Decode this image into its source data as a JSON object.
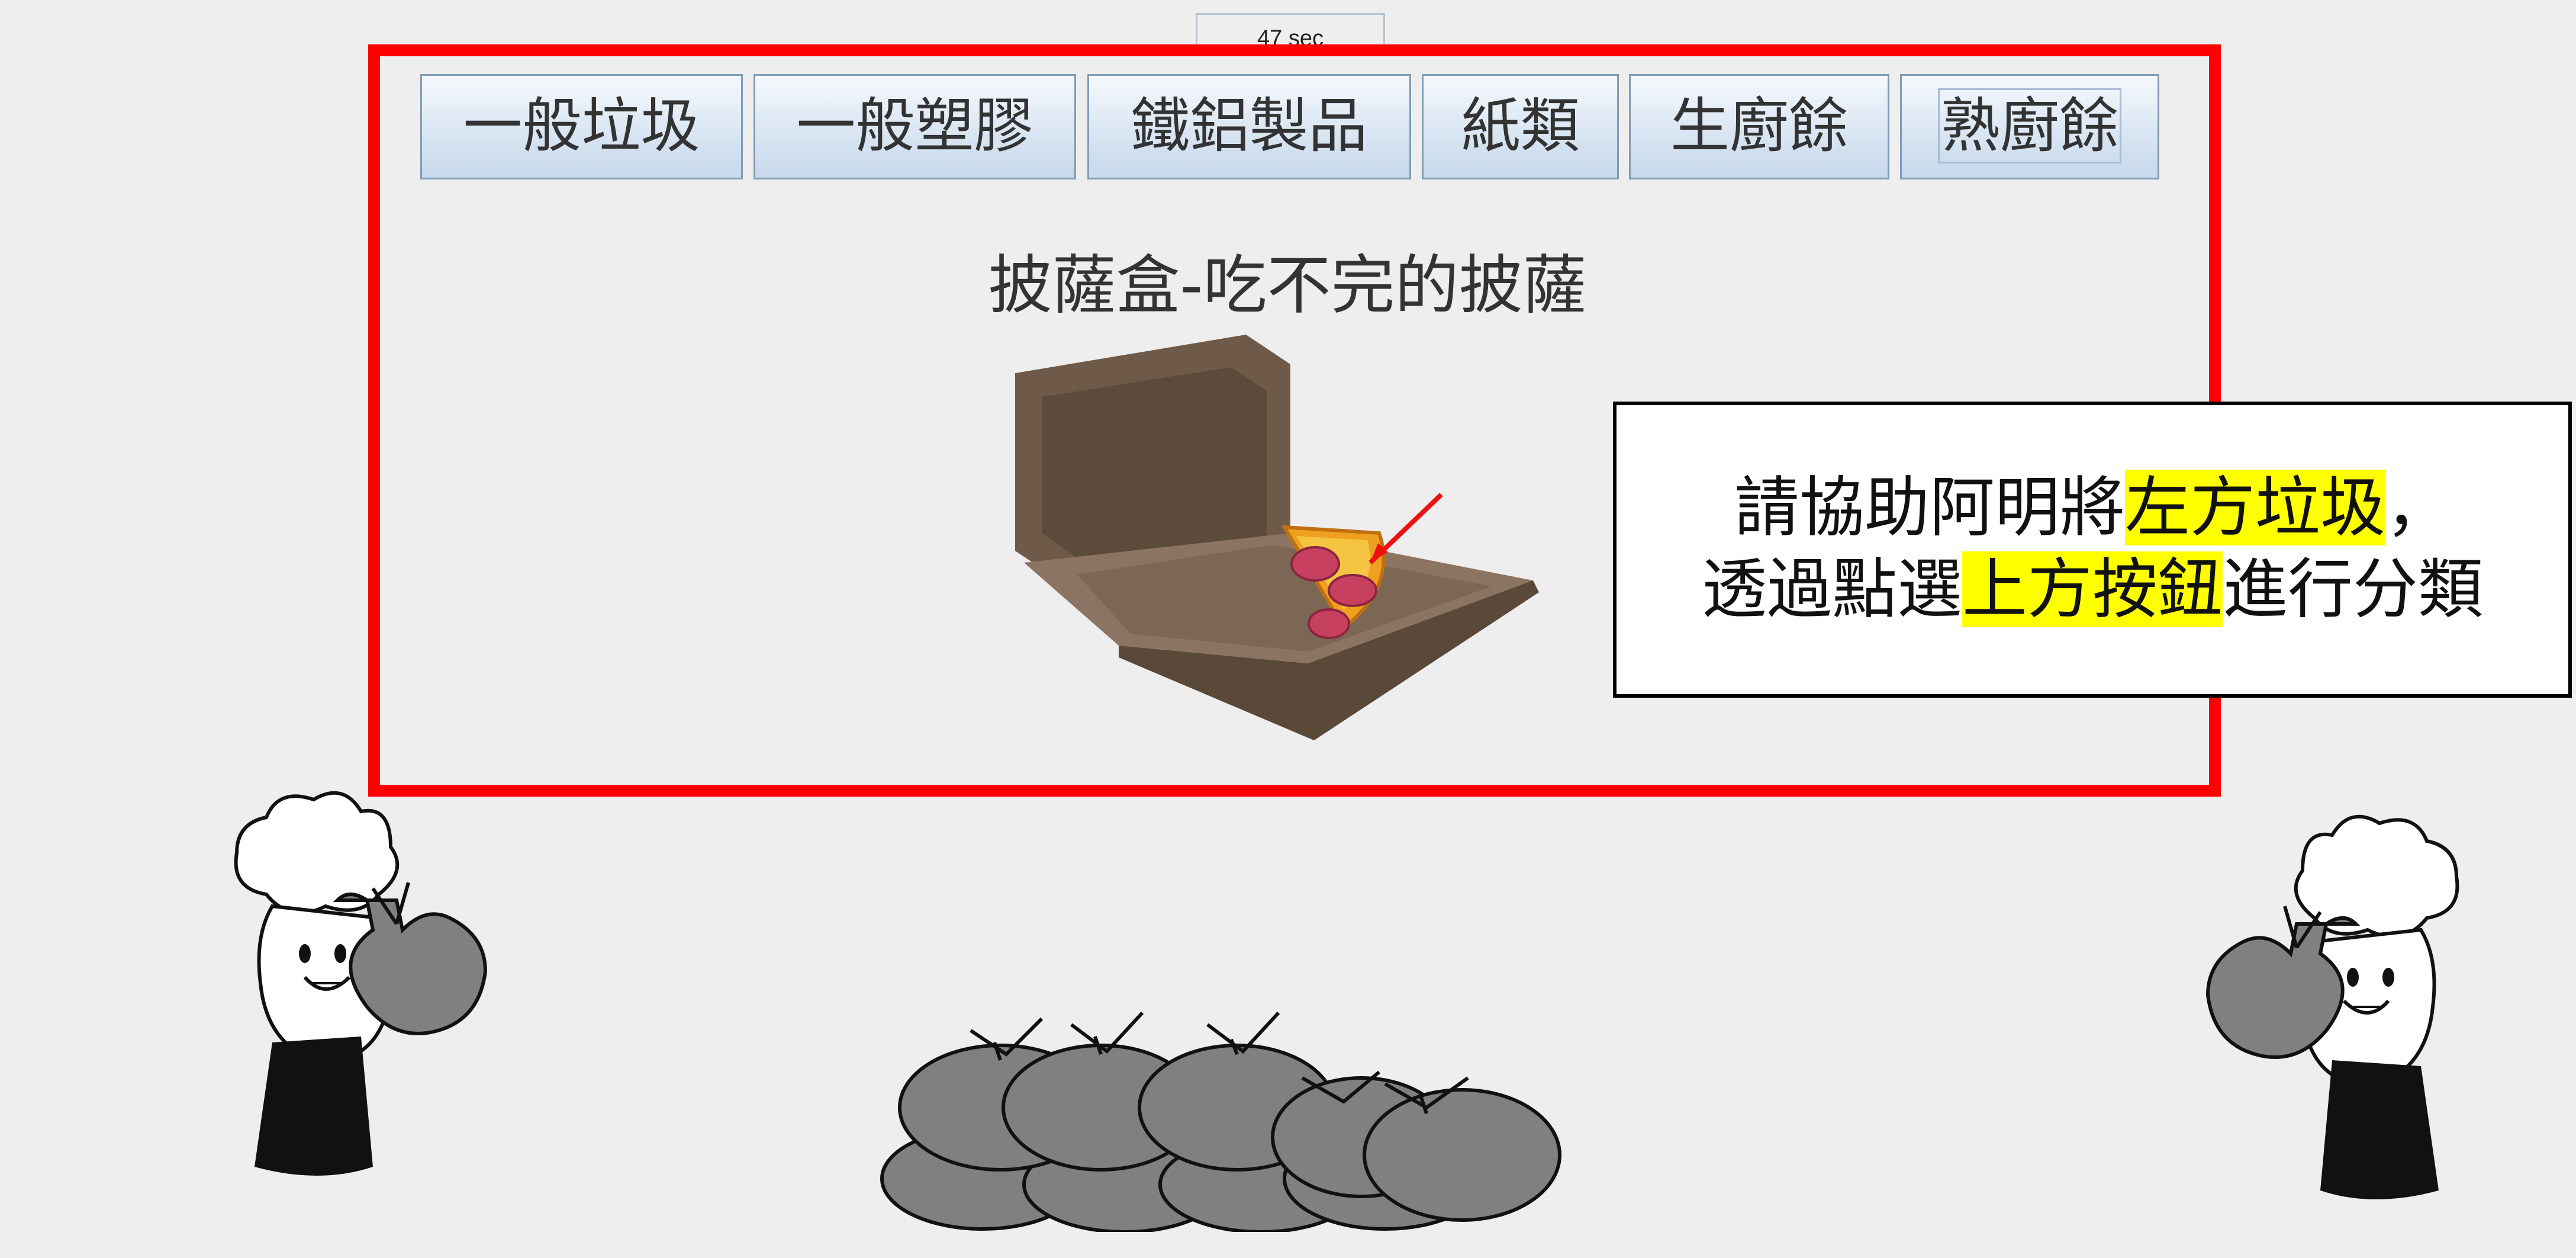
{
  "timer": {
    "text": "47 sec"
  },
  "categories": [
    {
      "label": "一般垃圾"
    },
    {
      "label": "一般塑膠"
    },
    {
      "label": "鐵鋁製品"
    },
    {
      "label": "紙類"
    },
    {
      "label": "生廚餘"
    },
    {
      "label": "熟廚餘"
    }
  ],
  "item": {
    "title": "披薩盒-吃不完的披薩"
  },
  "instruction": {
    "line1_before": "請協助阿明將",
    "line1_highlight": "左方垃圾",
    "line1_after": "，",
    "line2_before": "透過點選",
    "line2_highlight": "上方按鈕",
    "line2_after": "進行分類"
  },
  "colors": {
    "frame": "#ff0000",
    "highlight": "#ffff00",
    "button_border": "#7f9db9",
    "bag": "#808080",
    "background": "#eeeeee"
  },
  "icons": {
    "item_image": "pizza-box-icon",
    "mascot": "chef-mascot-icon",
    "bags": "garbage-bags-icon"
  }
}
